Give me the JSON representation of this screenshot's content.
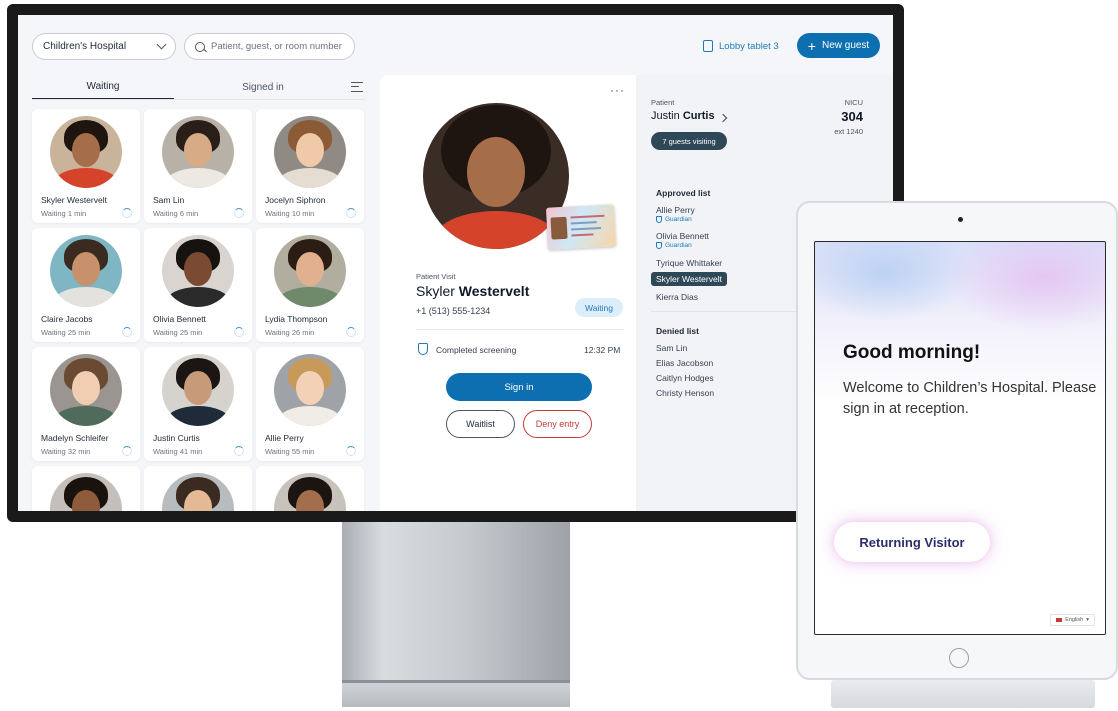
{
  "header": {
    "location": "Children's Hospital",
    "search_placeholder": "Patient, guest, or room number",
    "lobby_device": "Lobby tablet 3",
    "new_guest_label": "New guest"
  },
  "queue": {
    "tabs": [
      {
        "label": "Waiting"
      },
      {
        "label": "Signed in"
      }
    ],
    "cards": [
      {
        "name": "Skyler Westervelt",
        "wait": "Waiting 1 min"
      },
      {
        "name": "Sam Lin",
        "wait": "Waiting 6 min"
      },
      {
        "name": "Jocelyn Siphron",
        "wait": "Waiting 10 min"
      },
      {
        "name": "Claire Jacobs",
        "wait": "Waiting 25 min"
      },
      {
        "name": "Olivia Bennett",
        "wait": "Waiting 25 min"
      },
      {
        "name": "Lydia Thompson",
        "wait": "Waiting 26 min"
      },
      {
        "name": "Madelyn Schleifer",
        "wait": "Waiting 32 min"
      },
      {
        "name": "Justin Curtis",
        "wait": "Waiting 41 min"
      },
      {
        "name": "Allie Perry",
        "wait": "Waiting 55 min"
      },
      {
        "name": "",
        "wait": ""
      },
      {
        "name": "",
        "wait": ""
      },
      {
        "name": "",
        "wait": ""
      }
    ]
  },
  "visit": {
    "label": "Patient Visit",
    "first_name": "Skyler",
    "last_name": "Westervelt",
    "phone": "+1 (513) 555-1234",
    "status": "Waiting",
    "screening": "Completed screening",
    "screening_time": "12:32 PM",
    "sign_in_label": "Sign in",
    "waitlist_label": "Waitlist",
    "deny_label": "Deny entry"
  },
  "patient": {
    "label": "Patient",
    "first_name": "Justin",
    "last_name": "Curtis",
    "unit": "NICU",
    "room": "304",
    "ext": "ext 1240",
    "guests_visiting": "7 guests visiting",
    "approved_title": "Approved list",
    "approved": [
      {
        "name": "Allie Perry",
        "role": "Guardian"
      },
      {
        "name": "Olivia Bennett",
        "role": "Guardian"
      },
      {
        "name": "Tyrique Whittaker",
        "role": ""
      },
      {
        "name": "Skyler Westervelt",
        "role": ""
      },
      {
        "name": "Kierra Dias",
        "role": ""
      }
    ],
    "denied_title": "Denied list",
    "denied": [
      {
        "name": "Sam Lin"
      },
      {
        "name": "Elias Jacobson"
      },
      {
        "name": "Caitlyn Hodges"
      },
      {
        "name": "Christy Henson"
      }
    ]
  },
  "tablet": {
    "greeting": "Good morning!",
    "welcome": "Welcome to Children’s Hospital. Please sign in at reception.",
    "returning_label": "Returning Visitor",
    "language": "English"
  },
  "colors": {
    "primary": "#0d6fb0",
    "deny": "#c23b3b",
    "pill_dark": "#2f4858"
  }
}
